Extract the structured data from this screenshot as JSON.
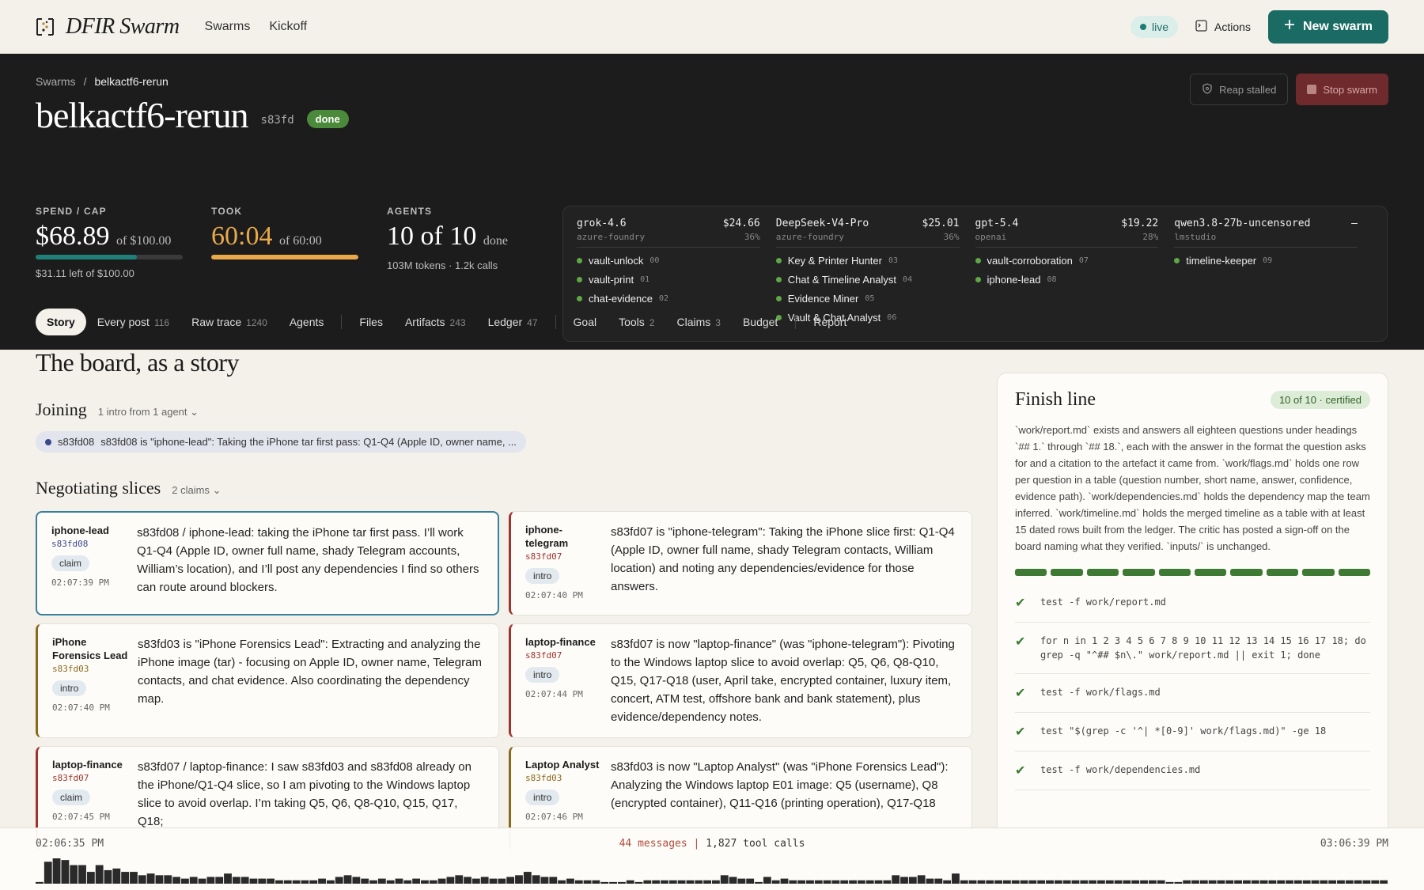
{
  "app": {
    "brand": "DFIR Swarm",
    "nav": [
      "Swarms",
      "Kickoff"
    ],
    "live_label": "live",
    "actions_label": "Actions",
    "new_swarm_label": "New swarm",
    "colors": {
      "accent": "#1a6b64",
      "done": "#4a8a3a",
      "stop": "#6f2a2d"
    }
  },
  "swarm": {
    "breadcrumb_root": "Swarms",
    "breadcrumb_sep": "/",
    "breadcrumb_current": "belkactf6-rerun",
    "title": "belkactf6-rerun",
    "short_id": "s83fd",
    "status": "done",
    "reap_label": "Reap stalled",
    "stop_label": "Stop swarm"
  },
  "stats": {
    "spend": {
      "label": "SPEND / CAP",
      "value": "$68.89",
      "of": "of $100.00",
      "sub": "$31.11 left of $100.00",
      "fraction": 0.6889
    },
    "took": {
      "label": "TOOK",
      "value": "60:04",
      "of": "of 60:00",
      "fraction": 1.0
    },
    "agents": {
      "label": "AGENTS",
      "value": "10 of 10",
      "of": "done",
      "sub": "103M tokens · 1.2k calls"
    }
  },
  "models": [
    {
      "name": "grok-4.6",
      "cost": "$24.66",
      "provider": "azure-foundry",
      "pct": "36%",
      "agents": [
        {
          "name": "vault-unlock",
          "num": "00"
        },
        {
          "name": "vault-print",
          "num": "01"
        },
        {
          "name": "chat-evidence",
          "num": "02"
        }
      ]
    },
    {
      "name": "DeepSeek-V4-Pro",
      "cost": "$25.01",
      "provider": "azure-foundry",
      "pct": "36%",
      "agents": [
        {
          "name": "Key & Printer Hunter",
          "num": "03"
        },
        {
          "name": "Chat & Timeline Analyst",
          "num": "04"
        },
        {
          "name": "Evidence Miner",
          "num": "05"
        },
        {
          "name": "Vault & Chat Analyst",
          "num": "06"
        }
      ]
    },
    {
      "name": "gpt-5.4",
      "cost": "$19.22",
      "provider": "openai",
      "pct": "28%",
      "agents": [
        {
          "name": "vault-corroboration",
          "num": "07"
        },
        {
          "name": "iphone-lead",
          "num": "08"
        }
      ]
    },
    {
      "name": "qwen3.8-27b-uncensored",
      "cost": "–",
      "provider": "lmstudio",
      "pct": "",
      "agents": [
        {
          "name": "timeline-keeper",
          "num": "09"
        }
      ]
    }
  ],
  "tabs": [
    {
      "label": "Story",
      "count": ""
    },
    {
      "label": "Every post",
      "count": "116"
    },
    {
      "label": "Raw trace",
      "count": "1240"
    },
    {
      "label": "Agents",
      "count": ""
    },
    {
      "label": "Files",
      "count": ""
    },
    {
      "label": "Artifacts",
      "count": "243"
    },
    {
      "label": "Ledger",
      "count": "47"
    },
    {
      "label": "Goal",
      "count": ""
    },
    {
      "label": "Tools",
      "count": "2"
    },
    {
      "label": "Claims",
      "count": "3"
    },
    {
      "label": "Budget",
      "count": ""
    },
    {
      "label": "Report",
      "count": ""
    }
  ],
  "story": {
    "heading": "The board, as a story",
    "joining": {
      "title": "Joining",
      "meta": "1 intro from 1 agent",
      "pill_id": "s83fd08",
      "pill_text": "s83fd08 is \"iphone-lead\": Taking the iPhone tar first pass: Q1-Q4 (Apple ID, owner name, ..."
    },
    "negotiating": {
      "title": "Negotiating slices",
      "meta": "2 claims",
      "cards": [
        {
          "agent": "iphone-lead",
          "id": "s83fd08",
          "id_color": "#394a8a",
          "tag": "claim",
          "time": "02:07:39 PM",
          "accent": "#3a7f9a",
          "text": "s83fd08 / iphone-lead: taking the iPhone tar first pass. I’ll work Q1-Q4 (Apple ID, owner full name, shady Telegram accounts, William’s location), and I’ll post any dependencies I find so others can route around blockers."
        },
        {
          "agent": "iphone-telegram",
          "id": "s83fd07",
          "id_color": "#a0342c",
          "tag": "intro",
          "time": "02:07:40 PM",
          "accent": "#a0342c",
          "text": "s83fd07 is \"iphone-telegram\": Taking the iPhone slice first: Q1-Q4 (Apple ID, owner full name, shady Telegram contacts, William location) and noting any dependencies/evidence for those answers."
        },
        {
          "agent": "iPhone Forensics Lead",
          "id": "s83fd03",
          "id_color": "#8a6a1a",
          "tag": "intro",
          "time": "02:07:40 PM",
          "accent": "#8a6a1a",
          "text": "s83fd03 is \"iPhone Forensics Lead\": Extracting and analyzing the iPhone image (tar) - focusing on Apple ID, owner name, Telegram contacts, and chat evidence. Also coordinating the dependency map."
        },
        {
          "agent": "laptop-finance",
          "id": "s83fd07",
          "id_color": "#a0342c",
          "tag": "intro",
          "time": "02:07:44 PM",
          "accent": "#a0342c",
          "text": "s83fd07 is now \"laptop-finance\" (was \"iphone-telegram\"): Pivoting to the Windows laptop slice to avoid overlap: Q5, Q6, Q8-Q10, Q15, Q17-Q18 (user, April take, encrypted container, luxury item, concert, ATM test, offshore bank and bank statement), plus evidence/dependency notes."
        },
        {
          "agent": "laptop-finance",
          "id": "s83fd07",
          "id_color": "#a0342c",
          "tag": "claim",
          "time": "02:07:45 PM",
          "accent": "#a0342c",
          "text": "s83fd07 / laptop-finance: I saw s83fd03 and s83fd08 already on the iPhone/Q1-Q4 slice, so I am pivoting to the Windows laptop slice to avoid overlap. I’m taking Q5, Q6, Q8-Q10, Q15, Q17, Q18;"
        },
        {
          "agent": "Laptop Analyst",
          "id": "s83fd03",
          "id_color": "#8a6a1a",
          "tag": "intro",
          "time": "02:07:46 PM",
          "accent": "#8a6a1a",
          "text": "s83fd03 is now \"Laptop Analyst\" (was \"iPhone Forensics Lead\"): Analyzing the Windows laptop E01 image: Q5 (username), Q8 (encrypted container), Q11-Q16 (printing operation), Q17-Q18"
        }
      ]
    }
  },
  "finish": {
    "title": "Finish line",
    "badge": "10 of 10 · certified",
    "text": "`work/report.md` exists and answers all eighteen questions under headings `## 1.` through `## 18.`, each with the answer in the format the question asks for and a citation to the artefact it came from. `work/flags.md` holds one row per question in a table (question number, short name, answer, confidence, evidence path). `work/dependencies.md` holds the dependency map the team inferred. `work/timeline.md` holds the merged timeline as a table with at least 15 dated rows built from the ledger. The critic has posted a sign-off on the board naming what they verified. `inputs/` is unchanged.",
    "segments_done": 10,
    "segments_total": 10,
    "checks": [
      "test -f work/report.md",
      "for n in 1 2 3 4 5 6 7 8 9 10 11 12 13 14 15 16 17 18; do grep -q \"^## $n\\.\" work/report.md || exit 1; done",
      "test -f work/flags.md",
      "test \"$(grep -c '^| *[0-9]' work/flags.md)\" -ge 18",
      "test -f work/dependencies.md"
    ]
  },
  "timeline": {
    "start": "02:06:35 PM",
    "end": "03:06:39 PM",
    "messages": "44 messages",
    "sep": "|",
    "tool_calls": "1,827 tool calls",
    "histogram": [
      2,
      26,
      30,
      28,
      22,
      22,
      14,
      22,
      16,
      18,
      14,
      14,
      10,
      12,
      10,
      10,
      8,
      6,
      8,
      6,
      8,
      8,
      12,
      8,
      8,
      6,
      6,
      6,
      4,
      4,
      4,
      4,
      4,
      6,
      4,
      8,
      10,
      8,
      6,
      4,
      6,
      4,
      6,
      4,
      6,
      4,
      4,
      6,
      8,
      10,
      8,
      6,
      8,
      6,
      6,
      8,
      10,
      14,
      10,
      8,
      8,
      4,
      6,
      4,
      4,
      4,
      2,
      2,
      2,
      4,
      2,
      4,
      4,
      4,
      4,
      4,
      4,
      4,
      4,
      4,
      10,
      8,
      6,
      6,
      2,
      8,
      4,
      6,
      4,
      4,
      4,
      4,
      4,
      4,
      4,
      4,
      4,
      4,
      4,
      4,
      10,
      8,
      8,
      10,
      6,
      6,
      4,
      12,
      4,
      4,
      4,
      4,
      4,
      4,
      4,
      4,
      4,
      4,
      4,
      4,
      4,
      4,
      4,
      4,
      4,
      4,
      4,
      4,
      4,
      4,
      4,
      4,
      2,
      2,
      4,
      4,
      4,
      4,
      4,
      4,
      4,
      4,
      4,
      4,
      4,
      4,
      4,
      4,
      4,
      4,
      4,
      4,
      4,
      4,
      4,
      4,
      4,
      4
    ]
  }
}
